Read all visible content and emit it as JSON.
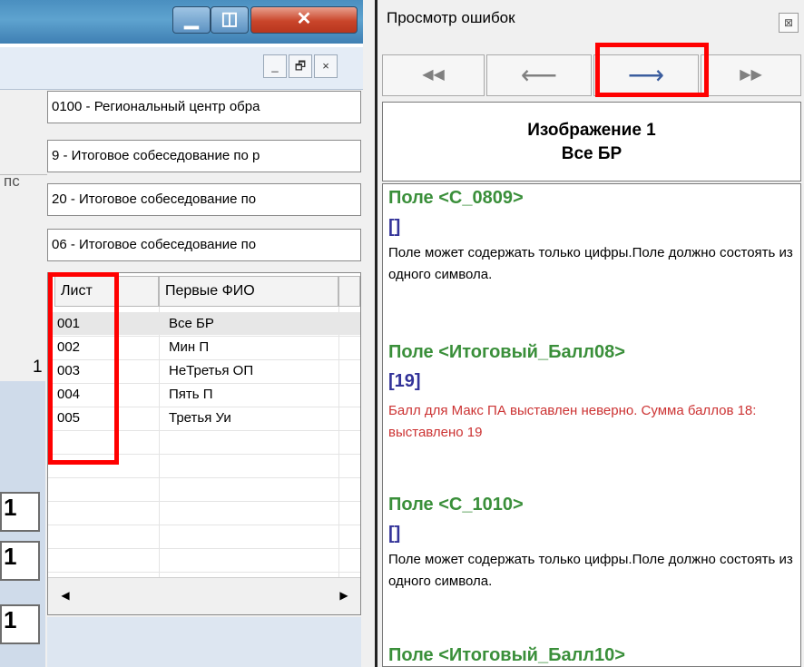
{
  "left": {
    "caption": {
      "min": "▁",
      "max": "◫",
      "close": "✕"
    },
    "mdi": {
      "min": "_",
      "restore": "🗗",
      "close": "×"
    },
    "fields": [
      "0100 - Региональный центр обра",
      "9 - Итоговое собеседование по р",
      "20 - Итоговое собеседование по",
      "06 - Итоговое собеседование по"
    ],
    "side_tab": "пс",
    "side_digit": "1",
    "grid": {
      "col_sheet": "Лист",
      "col_name": "Первые ФИО",
      "rows": [
        {
          "sheet": "001",
          "name": "Все БР"
        },
        {
          "sheet": "002",
          "name": "Мин П"
        },
        {
          "sheet": "003",
          "name": "НеТретья ОП"
        },
        {
          "sheet": "004",
          "name": "Пять П"
        },
        {
          "sheet": "005",
          "name": "Третья Уи"
        }
      ]
    },
    "scroll_left": "◀",
    "scroll_right": "▶",
    "partial_rows": [
      "1",
      "1",
      "1"
    ]
  },
  "errors_panel": {
    "title": "Просмотр ошибок",
    "close_icon": "⊠",
    "nav": {
      "first": "◀◀",
      "prev": "⟵",
      "next": "⟶",
      "last": "▶▶"
    },
    "image_title": "Изображение 1",
    "image_sub": "Все БР",
    "errors": [
      {
        "field": "Поле <С_0809>",
        "value": "[]",
        "message": "Поле может содержать только цифры.Поле должно состоять из одного символа.",
        "color": "#000000"
      },
      {
        "field": "Поле <Итоговый_Балл08>",
        "value": "[19]",
        "message": "Балл для Макс ПА выставлен неверно. Сумма баллов 18: выставлено 19",
        "color": "#cc3333"
      },
      {
        "field": "Поле <С_1010>",
        "value": "[]",
        "message": "Поле может содержать только цифры.Поле должно состоять из одного символа.",
        "color": "#000000"
      },
      {
        "field": "Поле <Итоговый_Балл10>"
      }
    ]
  },
  "highlight_color": "#ff0000"
}
